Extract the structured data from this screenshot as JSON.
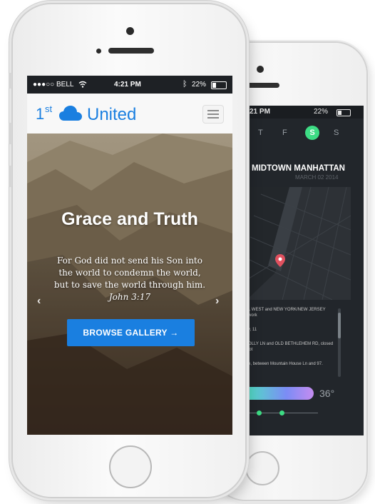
{
  "back_phone": {
    "status": {
      "time": "21 PM",
      "battery": "22%"
    },
    "days": [
      "T",
      "F",
      "S",
      "S"
    ],
    "active_day": "S",
    "title": "- MIDTOWN MANHATTAN",
    "date": "MARCH 02 2014",
    "list": [
      "L WEST and NEW YORK/NEW JERSEY",
      "work",
      "y, 11",
      "OLLY LN and OLD BETHLEHEM RD, closed",
      "lot",
      "e, between Mountain House Ln and 97."
    ],
    "temperature": "36°"
  },
  "front_phone": {
    "status": {
      "carrier": "●●●○○ BELL",
      "time": "4:21 PM",
      "battery": "22%"
    },
    "logo": {
      "number": "1",
      "superscript": "st",
      "name": "United"
    },
    "hero": {
      "title": "Grace and Truth",
      "verse": "For God did not send his Son into the world to condemn the world, but to save the world through him.",
      "reference": "John 3:17",
      "button": "BROWSE GALLERY →"
    }
  },
  "colors": {
    "brand": "#1a7fe0",
    "accent": "#3ddc84",
    "dark": "#22262b"
  },
  "icons": [
    "wifi-icon",
    "bluetooth-icon",
    "battery-icon",
    "cloud-icon",
    "menu-icon",
    "chevron-left-icon",
    "chevron-right-icon",
    "map-pin-icon"
  ]
}
